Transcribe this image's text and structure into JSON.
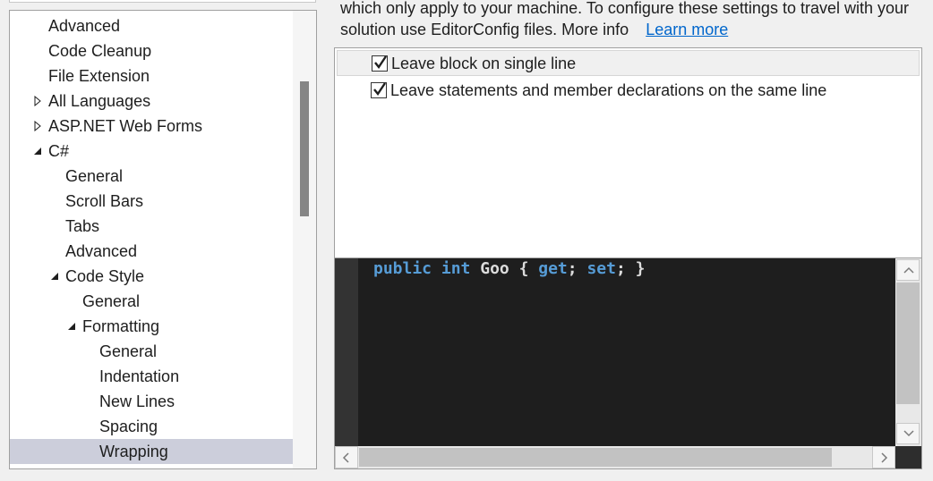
{
  "tree": {
    "items": [
      {
        "label": "Advanced",
        "expander": "none",
        "selected": false
      },
      {
        "label": "Code Cleanup",
        "expander": "none",
        "selected": false
      },
      {
        "label": "File Extension",
        "expander": "none",
        "selected": false
      },
      {
        "label": "All Languages",
        "expander": "collapsed",
        "selected": false
      },
      {
        "label": "ASP.NET Web Forms",
        "expander": "collapsed",
        "selected": false
      },
      {
        "label": "C#",
        "expander": "expanded",
        "selected": false
      },
      {
        "label": "General",
        "expander": "none",
        "selected": false
      },
      {
        "label": "Scroll Bars",
        "expander": "none",
        "selected": false
      },
      {
        "label": "Tabs",
        "expander": "none",
        "selected": false
      },
      {
        "label": "Advanced",
        "expander": "none",
        "selected": false
      },
      {
        "label": "Code Style",
        "expander": "expanded",
        "selected": false
      },
      {
        "label": "General",
        "expander": "none",
        "selected": false
      },
      {
        "label": "Formatting",
        "expander": "expanded",
        "selected": false
      },
      {
        "label": "General",
        "expander": "none",
        "selected": false
      },
      {
        "label": "Indentation",
        "expander": "none",
        "selected": false
      },
      {
        "label": "New Lines",
        "expander": "none",
        "selected": false
      },
      {
        "label": "Spacing",
        "expander": "none",
        "selected": false
      },
      {
        "label": "Wrapping",
        "expander": "none",
        "selected": true
      }
    ]
  },
  "info": {
    "line1": "which only apply to your machine. To configure these settings to travel with your",
    "line2": "solution use EditorConfig files. More info",
    "link": "Learn more"
  },
  "options": [
    {
      "label": "Leave block on single line",
      "checked": true
    },
    {
      "label": "Leave statements and member declarations on the same line",
      "checked": true
    }
  ],
  "preview": {
    "tokens": [
      {
        "text": "public",
        "kind": "keyword"
      },
      {
        "text": " ",
        "kind": "plain"
      },
      {
        "text": "int",
        "kind": "keyword"
      },
      {
        "text": " Goo { ",
        "kind": "plain"
      },
      {
        "text": "get",
        "kind": "keyword"
      },
      {
        "text": "; ",
        "kind": "plain"
      },
      {
        "text": "set",
        "kind": "keyword"
      },
      {
        "text": "; }",
        "kind": "plain"
      }
    ]
  },
  "colors": {
    "selection": "#cccedb",
    "link": "#0066cc",
    "editor_bg": "#1e1e1e",
    "keyword": "#569cd6"
  },
  "icons": {
    "expanded": "triangle-down-right-icon",
    "collapsed": "triangle-right-outline-icon",
    "check": "check-mark-icon"
  }
}
